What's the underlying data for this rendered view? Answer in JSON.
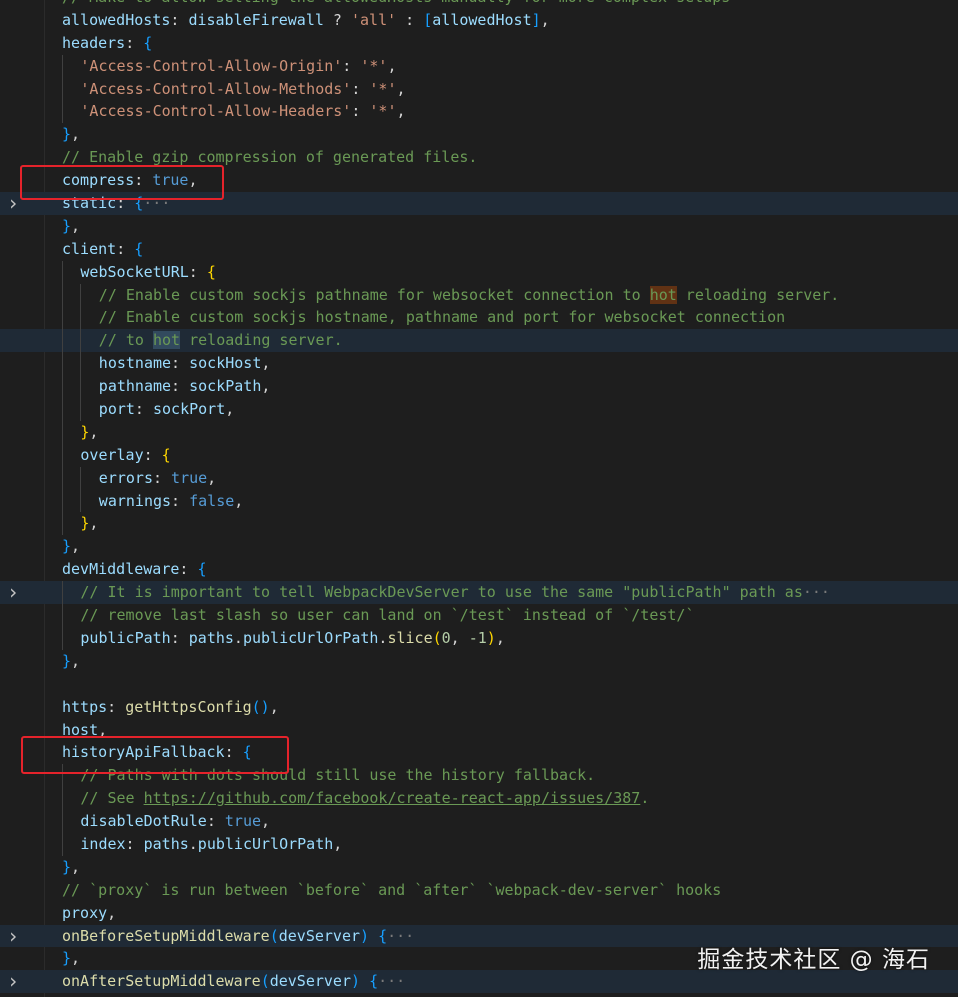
{
  "colors": {
    "background": "#1e1e1e",
    "property": "#9cdcfe",
    "string": "#ce9178",
    "keyword": "#569cd6",
    "comment": "#6a9955",
    "function": "#dcdcaa",
    "number": "#b5cea8",
    "punctuation": "#d4d4d4",
    "bracket_level_1": "#ffd700",
    "bracket_level_2": "#da70d6",
    "bracket_level_3": "#179fff",
    "highlight_box": "#e5232b",
    "search_match": "#613214"
  },
  "fold_icon": "chevron-right-icon",
  "lines": [
    {
      "indent": 0,
      "tokens": [
        {
          "t": "// Make to allow setting the allowedHosts manually for more complex setups",
          "c": "com"
        }
      ]
    },
    {
      "indent": 0,
      "tokens": [
        {
          "t": "allowedHosts",
          "c": "key"
        },
        {
          "t": ": ",
          "c": "p"
        },
        {
          "t": "disableFirewall",
          "c": "key"
        },
        {
          "t": " ? ",
          "c": "p"
        },
        {
          "t": "'all'",
          "c": "str"
        },
        {
          "t": " : ",
          "c": "p"
        },
        {
          "t": "[",
          "c": "b3"
        },
        {
          "t": "allowedHost",
          "c": "key"
        },
        {
          "t": "]",
          "c": "b3"
        },
        {
          "t": ",",
          "c": "p"
        }
      ]
    },
    {
      "indent": 0,
      "tokens": [
        {
          "t": "headers",
          "c": "key"
        },
        {
          "t": ": ",
          "c": "p"
        },
        {
          "t": "{",
          "c": "b3"
        }
      ]
    },
    {
      "indent": 1,
      "tokens": [
        {
          "t": "'Access-Control-Allow-Origin'",
          "c": "str"
        },
        {
          "t": ": ",
          "c": "p"
        },
        {
          "t": "'*'",
          "c": "str"
        },
        {
          "t": ",",
          "c": "p"
        }
      ]
    },
    {
      "indent": 1,
      "tokens": [
        {
          "t": "'Access-Control-Allow-Methods'",
          "c": "str"
        },
        {
          "t": ": ",
          "c": "p"
        },
        {
          "t": "'*'",
          "c": "str"
        },
        {
          "t": ",",
          "c": "p"
        }
      ]
    },
    {
      "indent": 1,
      "tokens": [
        {
          "t": "'Access-Control-Allow-Headers'",
          "c": "str"
        },
        {
          "t": ": ",
          "c": "p"
        },
        {
          "t": "'*'",
          "c": "str"
        },
        {
          "t": ",",
          "c": "p"
        }
      ]
    },
    {
      "indent": 0,
      "tokens": [
        {
          "t": "}",
          "c": "b3"
        },
        {
          "t": ",",
          "c": "p"
        }
      ]
    },
    {
      "indent": 0,
      "tokens": [
        {
          "t": "// Enable gzip compression of generated files.",
          "c": "com"
        }
      ]
    },
    {
      "indent": 0,
      "tokens": [
        {
          "t": "compress",
          "c": "key"
        },
        {
          "t": ": ",
          "c": "p"
        },
        {
          "t": "true",
          "c": "kw"
        },
        {
          "t": ",",
          "c": "p"
        }
      ]
    },
    {
      "indent": 0,
      "fold": true,
      "hl": true,
      "tokens": [
        {
          "t": "static",
          "c": "key"
        },
        {
          "t": ": ",
          "c": "p"
        },
        {
          "t": "{",
          "c": "b3"
        },
        {
          "t": "···",
          "c": "dot"
        }
      ]
    },
    {
      "indent": 0,
      "tokens": [
        {
          "t": "}",
          "c": "b3"
        },
        {
          "t": ",",
          "c": "p"
        }
      ]
    },
    {
      "indent": 0,
      "tokens": [
        {
          "t": "client",
          "c": "key"
        },
        {
          "t": ": ",
          "c": "p"
        },
        {
          "t": "{",
          "c": "b3"
        }
      ]
    },
    {
      "indent": 1,
      "tokens": [
        {
          "t": "webSocketURL",
          "c": "key"
        },
        {
          "t": ": ",
          "c": "p"
        },
        {
          "t": "{",
          "c": "b1"
        }
      ]
    },
    {
      "indent": 2,
      "tokens": [
        {
          "t": "// Enable custom sockjs pathname for websocket connection to ",
          "c": "com"
        },
        {
          "t": "hot",
          "c": "com m1"
        },
        {
          "t": " reloading server.",
          "c": "com"
        }
      ]
    },
    {
      "indent": 2,
      "tokens": [
        {
          "t": "// Enable custom sockjs hostname, pathname and port for websocket connection",
          "c": "com"
        }
      ]
    },
    {
      "indent": 2,
      "hl": true,
      "tokens": [
        {
          "t": "// to ",
          "c": "com"
        },
        {
          "t": "hot",
          "c": "com m2"
        },
        {
          "t": " reloading server.",
          "c": "com"
        }
      ]
    },
    {
      "indent": 2,
      "tokens": [
        {
          "t": "hostname",
          "c": "key"
        },
        {
          "t": ": ",
          "c": "p"
        },
        {
          "t": "sockHost",
          "c": "key"
        },
        {
          "t": ",",
          "c": "p"
        }
      ]
    },
    {
      "indent": 2,
      "tokens": [
        {
          "t": "pathname",
          "c": "key"
        },
        {
          "t": ": ",
          "c": "p"
        },
        {
          "t": "sockPath",
          "c": "key"
        },
        {
          "t": ",",
          "c": "p"
        }
      ]
    },
    {
      "indent": 2,
      "tokens": [
        {
          "t": "port",
          "c": "key"
        },
        {
          "t": ": ",
          "c": "p"
        },
        {
          "t": "sockPort",
          "c": "key"
        },
        {
          "t": ",",
          "c": "p"
        }
      ]
    },
    {
      "indent": 1,
      "tokens": [
        {
          "t": "}",
          "c": "b1"
        },
        {
          "t": ",",
          "c": "p"
        }
      ]
    },
    {
      "indent": 1,
      "tokens": [
        {
          "t": "overlay",
          "c": "key"
        },
        {
          "t": ": ",
          "c": "p"
        },
        {
          "t": "{",
          "c": "b1"
        }
      ]
    },
    {
      "indent": 2,
      "tokens": [
        {
          "t": "errors",
          "c": "key"
        },
        {
          "t": ": ",
          "c": "p"
        },
        {
          "t": "true",
          "c": "kw"
        },
        {
          "t": ",",
          "c": "p"
        }
      ]
    },
    {
      "indent": 2,
      "tokens": [
        {
          "t": "warnings",
          "c": "key"
        },
        {
          "t": ": ",
          "c": "p"
        },
        {
          "t": "false",
          "c": "kw"
        },
        {
          "t": ",",
          "c": "p"
        }
      ]
    },
    {
      "indent": 1,
      "tokens": [
        {
          "t": "}",
          "c": "b1"
        },
        {
          "t": ",",
          "c": "p"
        }
      ]
    },
    {
      "indent": 0,
      "tokens": [
        {
          "t": "}",
          "c": "b3"
        },
        {
          "t": ",",
          "c": "p"
        }
      ]
    },
    {
      "indent": 0,
      "tokens": [
        {
          "t": "devMiddleware",
          "c": "key"
        },
        {
          "t": ": ",
          "c": "p"
        },
        {
          "t": "{",
          "c": "b3"
        }
      ]
    },
    {
      "indent": 1,
      "fold": true,
      "hl": true,
      "tokens": [
        {
          "t": "// It is important to tell WebpackDevServer to use the same \"publicPath\" path as",
          "c": "com"
        },
        {
          "t": "···",
          "c": "dot"
        }
      ]
    },
    {
      "indent": 1,
      "tokens": [
        {
          "t": "// remove last slash so user can land on `/test` instead of `/test/`",
          "c": "com"
        }
      ]
    },
    {
      "indent": 1,
      "tokens": [
        {
          "t": "publicPath",
          "c": "key"
        },
        {
          "t": ": ",
          "c": "p"
        },
        {
          "t": "paths",
          "c": "key"
        },
        {
          "t": ".",
          "c": "p"
        },
        {
          "t": "publicUrlOrPath",
          "c": "key"
        },
        {
          "t": ".",
          "c": "p"
        },
        {
          "t": "slice",
          "c": "fn"
        },
        {
          "t": "(",
          "c": "b1"
        },
        {
          "t": "0",
          "c": "num"
        },
        {
          "t": ", ",
          "c": "p"
        },
        {
          "t": "-1",
          "c": "num"
        },
        {
          "t": ")",
          "c": "b1"
        },
        {
          "t": ",",
          "c": "p"
        }
      ]
    },
    {
      "indent": 0,
      "tokens": [
        {
          "t": "}",
          "c": "b3"
        },
        {
          "t": ",",
          "c": "p"
        }
      ]
    },
    {
      "indent": 0,
      "tokens": []
    },
    {
      "indent": 0,
      "tokens": [
        {
          "t": "https",
          "c": "key"
        },
        {
          "t": ": ",
          "c": "p"
        },
        {
          "t": "getHttpsConfig",
          "c": "fn"
        },
        {
          "t": "()",
          "c": "b3"
        },
        {
          "t": ",",
          "c": "p"
        }
      ]
    },
    {
      "indent": 0,
      "tokens": [
        {
          "t": "host",
          "c": "key"
        },
        {
          "t": ",",
          "c": "p"
        }
      ]
    },
    {
      "indent": 0,
      "tokens": [
        {
          "t": "historyApiFallback",
          "c": "key"
        },
        {
          "t": ": ",
          "c": "p"
        },
        {
          "t": "{",
          "c": "b3"
        }
      ]
    },
    {
      "indent": 1,
      "tokens": [
        {
          "t": "// Paths with dots should still use the history fallback.",
          "c": "com"
        }
      ]
    },
    {
      "indent": 1,
      "tokens": [
        {
          "t": "// See ",
          "c": "com"
        },
        {
          "t": "https://github.com/facebook/create-react-app/issues/387",
          "c": "link"
        },
        {
          "t": ".",
          "c": "com"
        }
      ]
    },
    {
      "indent": 1,
      "tokens": [
        {
          "t": "disableDotRule",
          "c": "key"
        },
        {
          "t": ": ",
          "c": "p"
        },
        {
          "t": "true",
          "c": "kw"
        },
        {
          "t": ",",
          "c": "p"
        }
      ]
    },
    {
      "indent": 1,
      "tokens": [
        {
          "t": "index",
          "c": "key"
        },
        {
          "t": ": ",
          "c": "p"
        },
        {
          "t": "paths",
          "c": "key"
        },
        {
          "t": ".",
          "c": "p"
        },
        {
          "t": "publicUrlOrPath",
          "c": "key"
        },
        {
          "t": ",",
          "c": "p"
        }
      ]
    },
    {
      "indent": 0,
      "tokens": [
        {
          "t": "}",
          "c": "b3"
        },
        {
          "t": ",",
          "c": "p"
        }
      ]
    },
    {
      "indent": 0,
      "tokens": [
        {
          "t": "// `proxy` is run between `before` and `after` `webpack-dev-server` hooks",
          "c": "com"
        }
      ]
    },
    {
      "indent": 0,
      "tokens": [
        {
          "t": "proxy",
          "c": "key"
        },
        {
          "t": ",",
          "c": "p"
        }
      ]
    },
    {
      "indent": 0,
      "fold": true,
      "hl": true,
      "tokens": [
        {
          "t": "onBeforeSetupMiddleware",
          "c": "fn"
        },
        {
          "t": "(",
          "c": "b3"
        },
        {
          "t": "devServer",
          "c": "key"
        },
        {
          "t": ")",
          "c": "b3"
        },
        {
          "t": " ",
          "c": "p"
        },
        {
          "t": "{",
          "c": "b3"
        },
        {
          "t": "···",
          "c": "dot"
        }
      ]
    },
    {
      "indent": 0,
      "tokens": [
        {
          "t": "}",
          "c": "b3"
        },
        {
          "t": ",",
          "c": "p"
        }
      ]
    },
    {
      "indent": 0,
      "fold": true,
      "hl": true,
      "tokens": [
        {
          "t": "onAfterSetupMiddleware",
          "c": "fn"
        },
        {
          "t": "(",
          "c": "b3"
        },
        {
          "t": "devServer",
          "c": "key"
        },
        {
          "t": ")",
          "c": "b3"
        },
        {
          "t": " ",
          "c": "p"
        },
        {
          "t": "{",
          "c": "b3"
        },
        {
          "t": "···",
          "c": "dot"
        }
      ]
    },
    {
      "indent": 0,
      "tokens": [
        {
          "t": "}",
          "c": "b3"
        }
      ]
    }
  ],
  "watermark": "掘金技术社区 @ 海石"
}
